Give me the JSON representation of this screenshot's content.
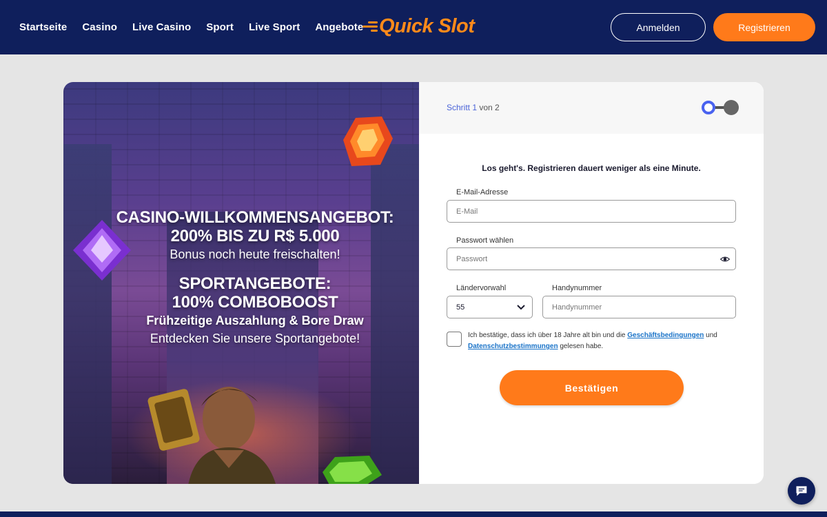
{
  "header": {
    "nav": [
      "Startseite",
      "Casino",
      "Live Casino",
      "Sport",
      "Live Sport",
      "Angebote"
    ],
    "logo_text": "Quick Slot",
    "login_label": "Anmelden",
    "register_label": "Registrieren"
  },
  "promo": {
    "casino_title_1": "CASINO-WILLKOMMENSANGEBOT:",
    "casino_title_2": "200% BIS ZU R$ 5.000",
    "casino_sub": "Bonus noch heute freischalten!",
    "sport_title_1": "SPORTANGEBOTE:",
    "sport_title_2": "100% COMBOBOOST",
    "sport_sub": "Frühzeitige Auszahlung & Bore Draw",
    "sport_cta": "Entdecken Sie unsere Sportangebote!"
  },
  "form": {
    "step_current": "Schritt 1",
    "step_total": "von 2",
    "intro": "Los geht's. Registrieren dauert weniger als eine Minute.",
    "email_label": "E-Mail-Adresse",
    "email_placeholder": "E-Mail",
    "password_label": "Passwort wählen",
    "password_placeholder": "Passwort",
    "country_code_label": "Ländervorwahl",
    "country_code_value": "55",
    "phone_label": "Handynummer",
    "phone_placeholder": "Handynummer",
    "terms_part1": "Ich bestätige, dass ich über 18 Jahre alt bin und die",
    "terms_link1": "Geschäftsbedingungen",
    "terms_part2": "und",
    "terms_link2": "Datenschutzbestimmungen",
    "terms_part3": "gelesen habe.",
    "confirm_label": "Bestätigen"
  },
  "colors": {
    "header_bg": "#0f1f5c",
    "accent_orange": "#ff7a1a",
    "step_active": "#4a63f0",
    "link_blue": "#1a73c8"
  },
  "icons": {
    "password_toggle": "eye-icon",
    "select_arrow": "chevron-down-icon",
    "chat": "chat-icon"
  }
}
